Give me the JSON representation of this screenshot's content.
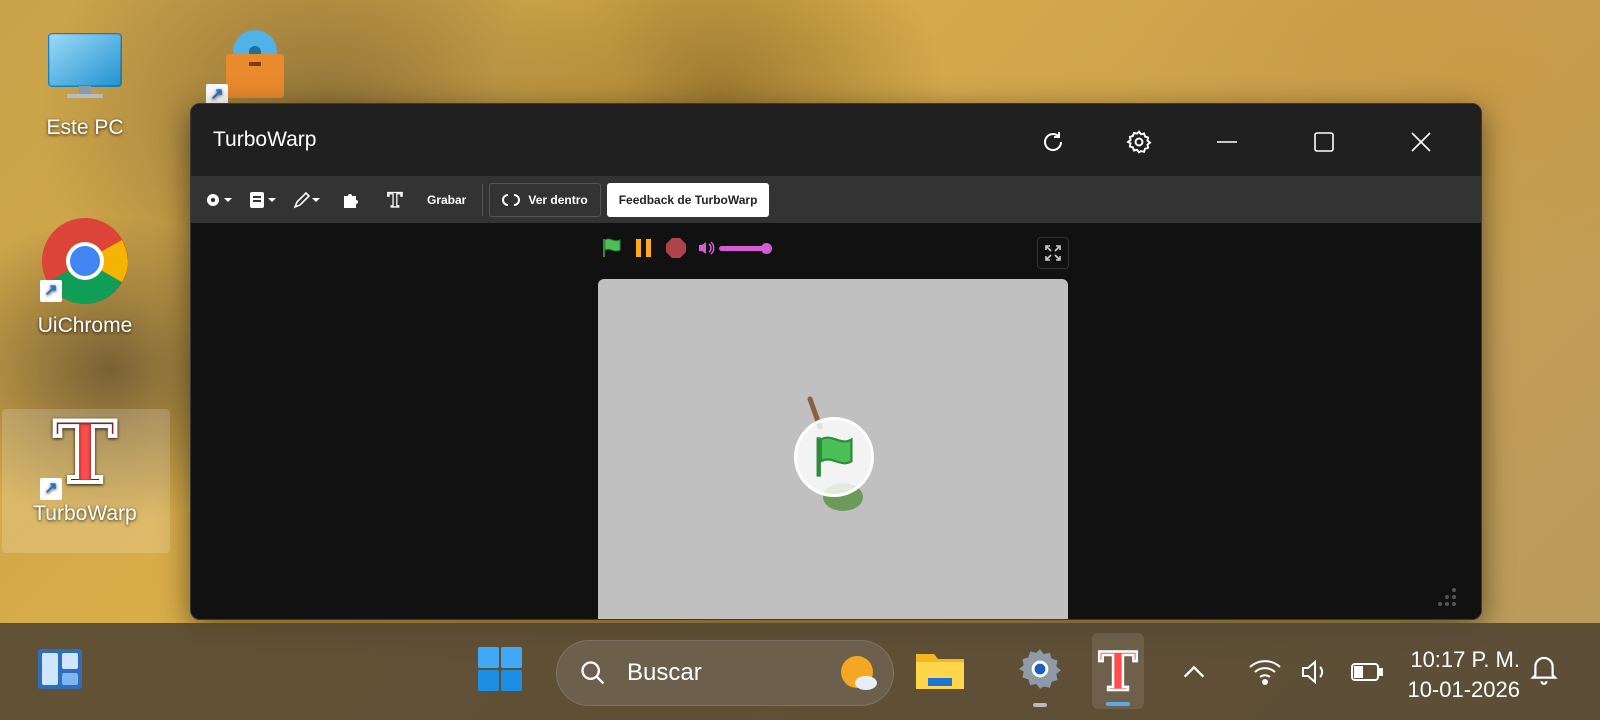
{
  "desktop": {
    "icons": [
      {
        "label": "Este PC"
      },
      {
        "label": ""
      },
      {
        "label": "UiChrome"
      },
      {
        "label": "TurboWarp"
      }
    ]
  },
  "window": {
    "title": "TurboWarp",
    "menubar": {
      "record_label": "Grabar",
      "see_inside_label": "Ver dentro",
      "feedback_label": "Feedback de TurboWarp"
    }
  },
  "taskbar": {
    "search_placeholder": "Buscar",
    "clock_time": "10:17 P. M.",
    "clock_date": "10-01-2026"
  },
  "colors": {
    "accent_green": "#4cbf56",
    "pause_orange": "#ffab19",
    "stop_red": "#b0434a",
    "volume_purple": "#d65cd6"
  }
}
